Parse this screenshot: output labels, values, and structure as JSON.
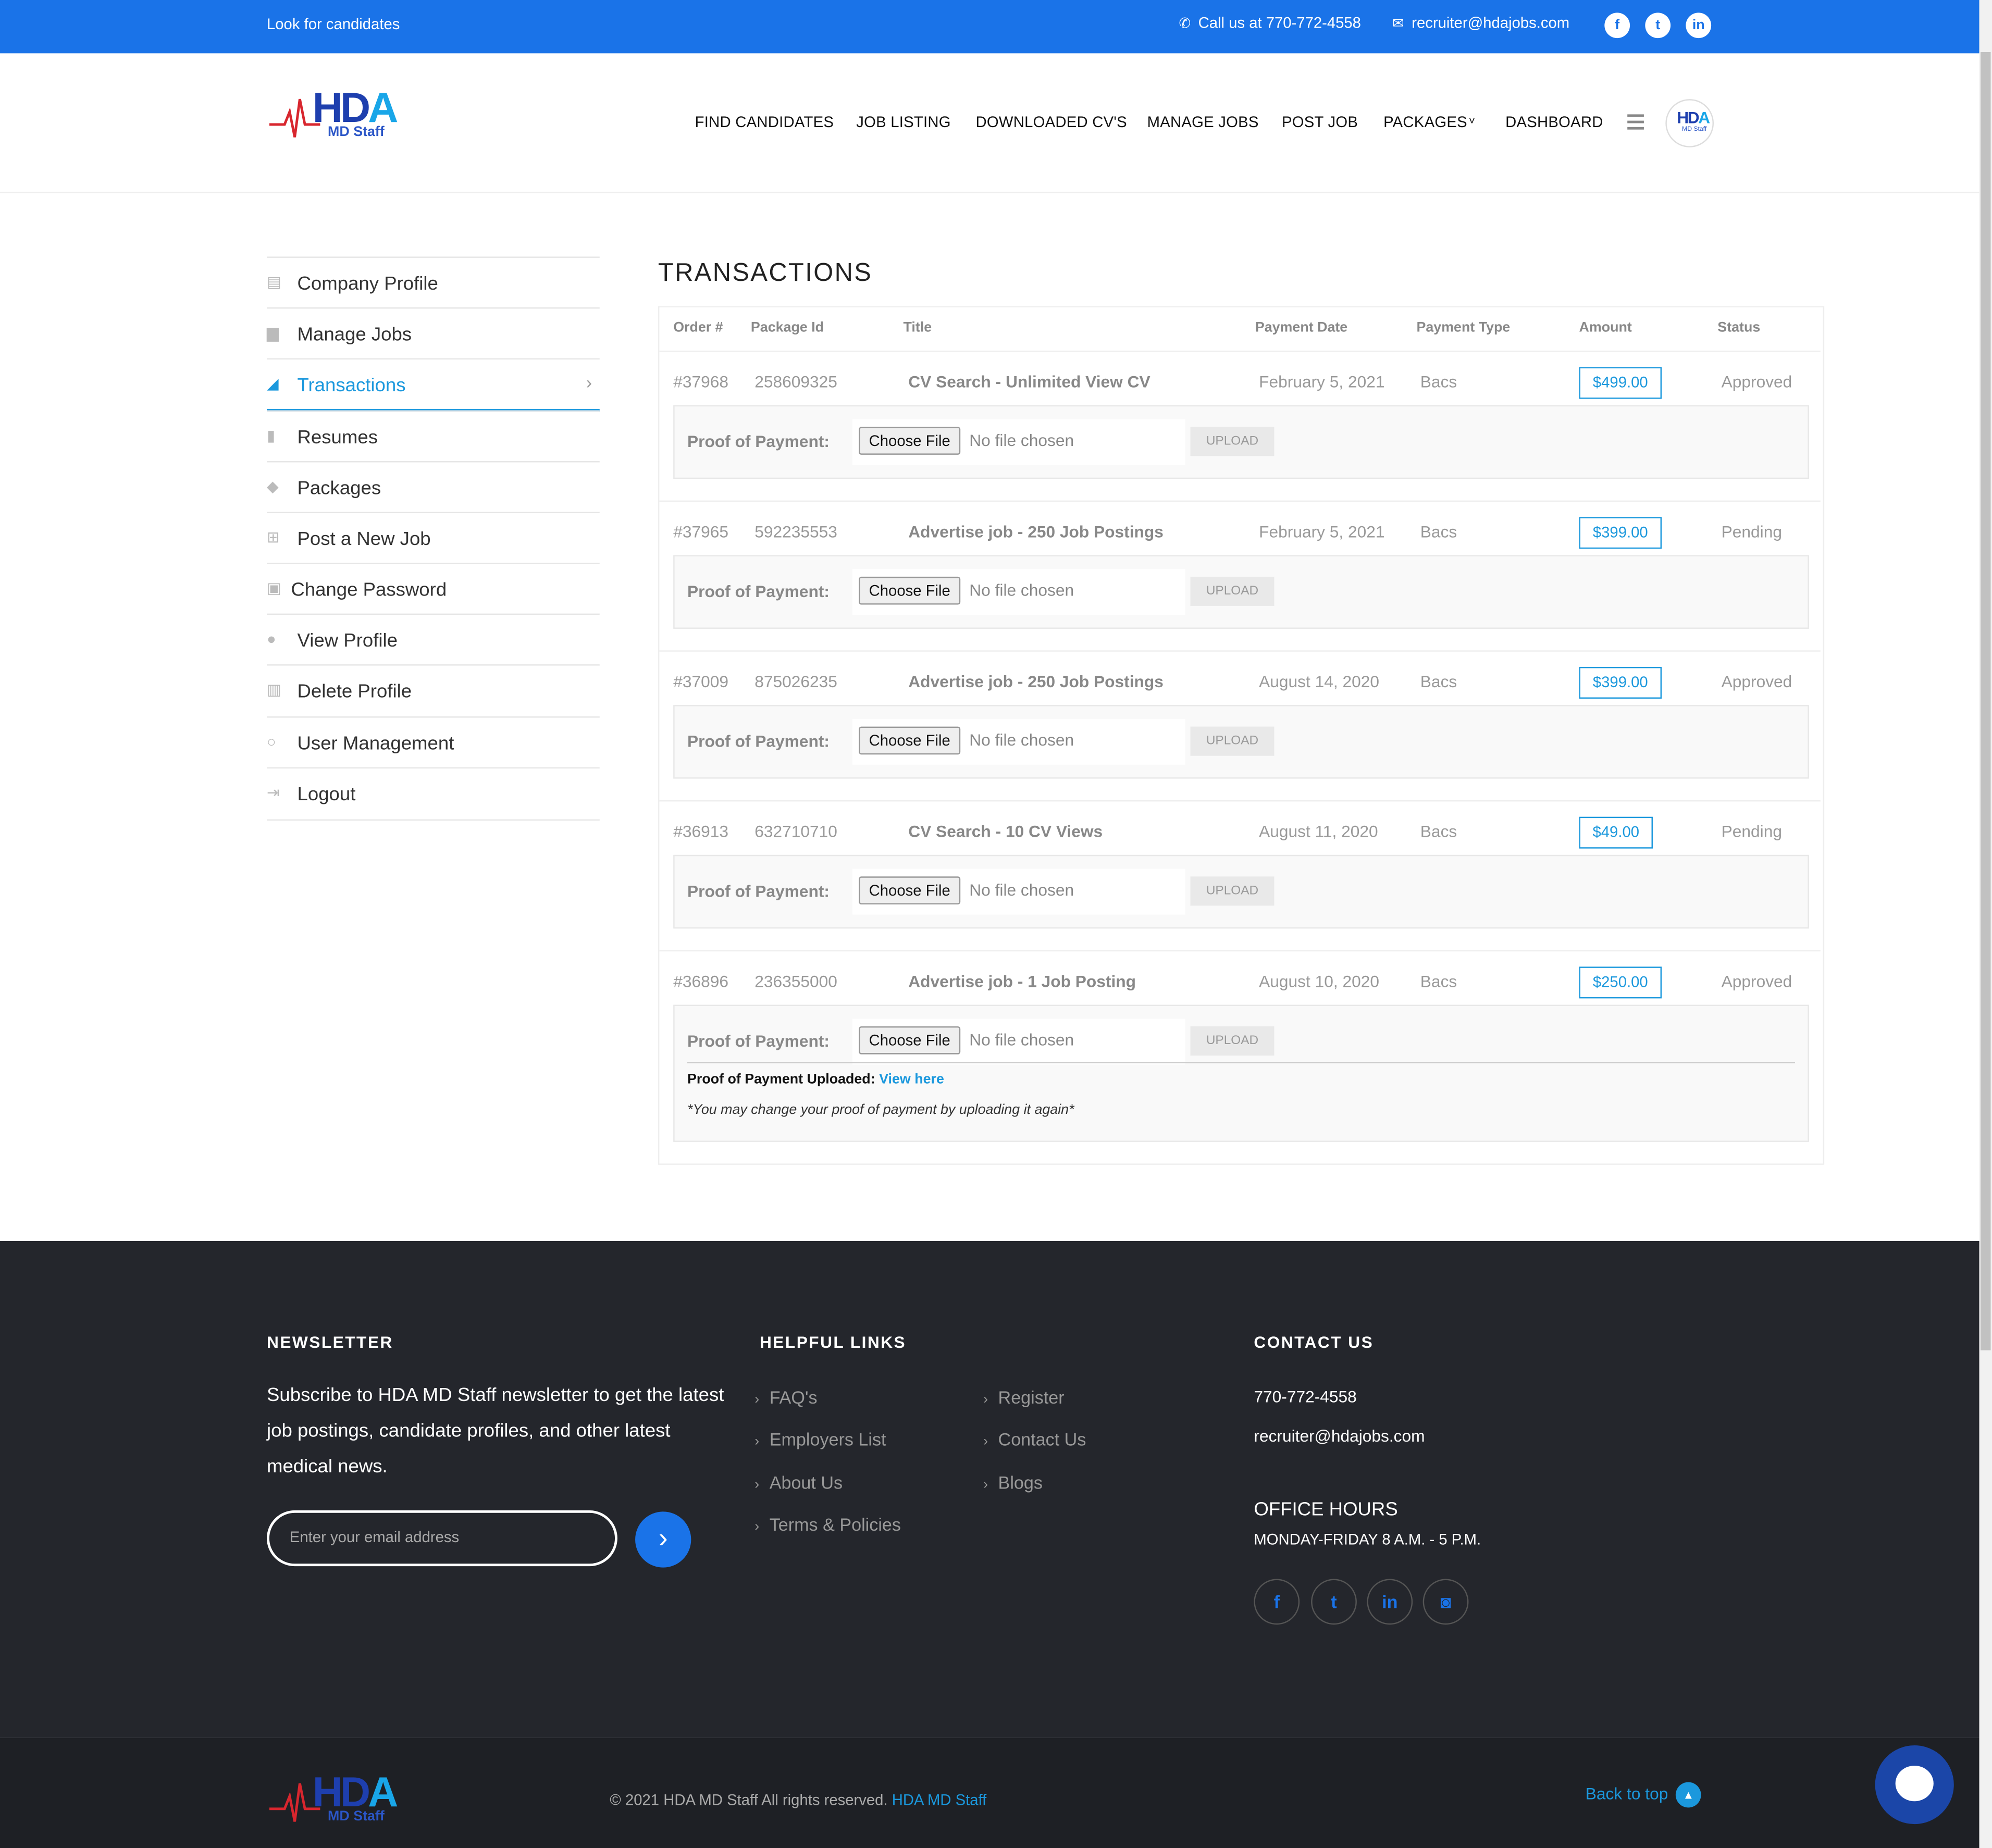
{
  "topbar": {
    "left_text": "Look for candidates",
    "phone": "Call us at 770-772-4558",
    "email": "recruiter@hdajobs.com"
  },
  "logo": {
    "hda": "HD",
    "hda_a": "A",
    "sub": "MD Staff"
  },
  "nav": {
    "items": [
      "FIND CANDIDATES",
      "JOB LISTING",
      "DOWNLOADED CV'S",
      "MANAGE JOBS",
      "POST JOB",
      "PACKAGES",
      "DASHBOARD"
    ]
  },
  "sidebar": {
    "items": [
      {
        "label": "Company Profile",
        "icon": "building-icon"
      },
      {
        "label": "Manage Jobs",
        "icon": "briefcase-icon"
      },
      {
        "label": "Transactions",
        "icon": "chart-icon"
      },
      {
        "label": "Resumes",
        "icon": "document-icon"
      },
      {
        "label": "Packages",
        "icon": "tag-icon"
      },
      {
        "label": "Post a New Job",
        "icon": "plus-box-icon"
      },
      {
        "label": "Change Password",
        "icon": "lock-icon"
      },
      {
        "label": "View Profile",
        "icon": "user-icon"
      },
      {
        "label": "Delete Profile",
        "icon": "trash-icon"
      },
      {
        "label": "User Management",
        "icon": "user-outline-icon"
      },
      {
        "label": "Logout",
        "icon": "logout-icon"
      }
    ],
    "active_index": 2
  },
  "main": {
    "title": "TRANSACTIONS",
    "headers": [
      "Order #",
      "Package Id",
      "Title",
      "Payment Date",
      "Payment Type",
      "Amount",
      "Status"
    ],
    "proof_label": "Proof of Payment:",
    "choose_file": "Choose File",
    "no_file": "No file chosen",
    "upload": "UPLOAD",
    "rows": [
      {
        "order": "#37968",
        "package": "258609325",
        "title": "CV Search - Unlimited View CV",
        "date": "February 5, 2021",
        "type": "Bacs",
        "amount": "$499.00",
        "status": "Approved"
      },
      {
        "order": "#37965",
        "package": "592235553",
        "title": "Advertise job - 250 Job Postings",
        "date": "February 5, 2021",
        "type": "Bacs",
        "amount": "$399.00",
        "status": "Pending"
      },
      {
        "order": "#37009",
        "package": "875026235",
        "title": "Advertise job - 250 Job Postings",
        "date": "August 14, 2020",
        "type": "Bacs",
        "amount": "$399.00",
        "status": "Approved"
      },
      {
        "order": "#36913",
        "package": "632710710",
        "title": "CV Search - 10 CV Views",
        "date": "August 11, 2020",
        "type": "Bacs",
        "amount": "$49.00",
        "status": "Pending"
      },
      {
        "order": "#36896",
        "package": "236355000",
        "title": "Advertise job - 1 Job Posting",
        "date": "August 10, 2020",
        "type": "Bacs",
        "amount": "$250.00",
        "status": "Approved"
      }
    ],
    "uploaded_label": "Proof of Payment Uploaded",
    "uploaded_link": "View here",
    "change_note": "*You may change your proof of payment by uploading it again*"
  },
  "footer": {
    "newsletter_title": "NEWSLETTER",
    "newsletter_text": "Subscribe to HDA MD Staff newsletter to get the latest job postings, candidate profiles, and other latest medical news.",
    "email_placeholder": "Enter your email address",
    "links_title": "HELPFUL LINKS",
    "links_col1": [
      "FAQ's",
      "Employers List",
      "About Us",
      "Terms & Policies"
    ],
    "links_col2": [
      "Register",
      "Contact Us",
      "Blogs"
    ],
    "contact_title": "CONTACT US",
    "phone": "770-772-4558",
    "email": "recruiter@hdajobs.com",
    "hours_title": "OFFICE HOURS",
    "hours": "MONDAY-FRIDAY 8 A.M. - 5 P.M.",
    "copyright": "© 2021 HDA MD Staff All rights reserved.",
    "copyright_brand": "HDA MD Staff",
    "back_to_top": "Back to top"
  },
  "colors": {
    "brand_blue": "#1a73e8",
    "accent": "#1b98dd",
    "footer_bg": "#24262c"
  }
}
